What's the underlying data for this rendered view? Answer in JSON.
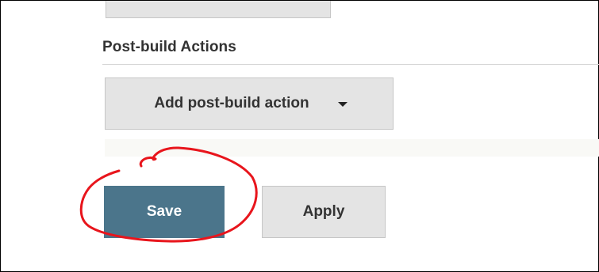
{
  "section": {
    "title": "Post-build Actions"
  },
  "add_action": {
    "label": "Add post-build action",
    "icon": "caret-down-icon"
  },
  "form_buttons": {
    "save_label": "Save",
    "apply_label": "Apply"
  },
  "colors": {
    "save_button_bg": "#4b758b",
    "secondary_button_bg": "#e4e4e4",
    "annotation_stroke": "#e8151c"
  },
  "annotation": {
    "type": "hand-drawn circle",
    "target": "save-button"
  }
}
